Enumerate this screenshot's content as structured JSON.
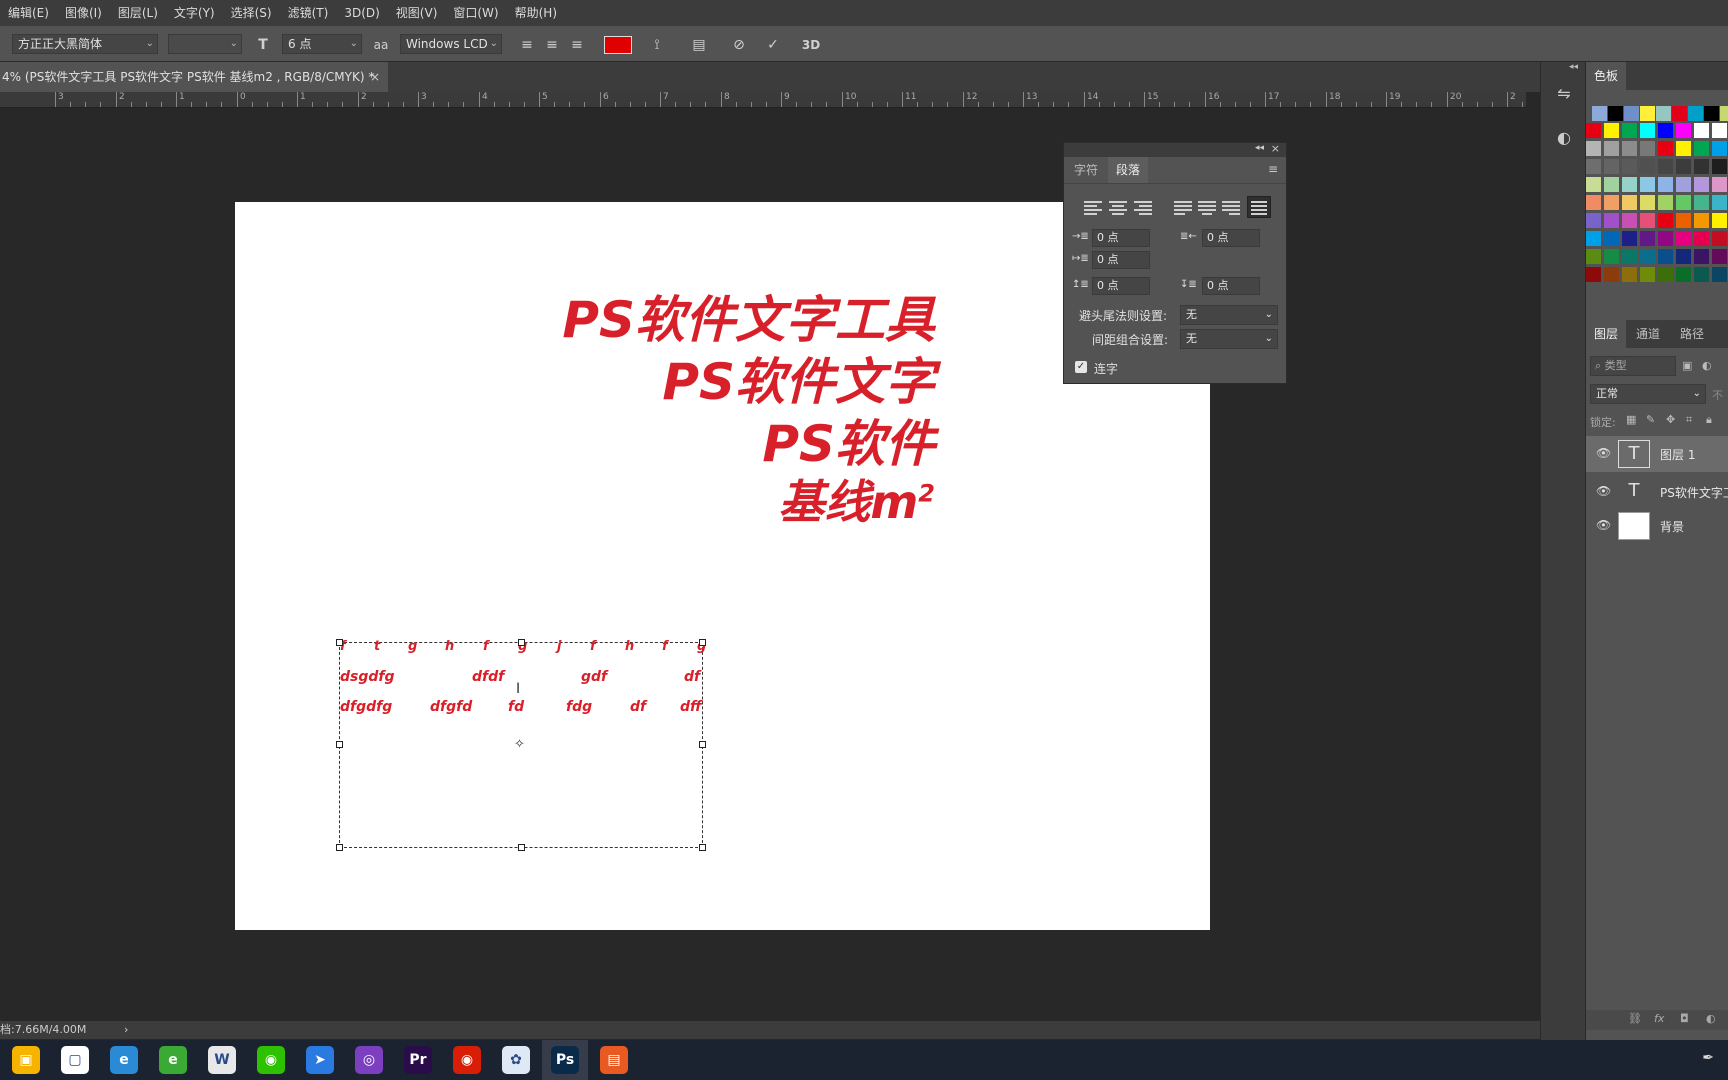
{
  "menu": [
    "编辑(E)",
    "图像(I)",
    "图层(L)",
    "文字(Y)",
    "选择(S)",
    "滤镜(T)",
    "3D(D)",
    "视图(V)",
    "窗口(W)",
    "帮助(H)"
  ],
  "options": {
    "font_family": "方正正大黑简体",
    "font_size": "6 点",
    "antialias_prefix": "aa",
    "antialias": "Windows LCD",
    "text_color": "#e00000",
    "threed_label": "3D"
  },
  "document_tab": {
    "title": "4% (PS软件文字工具 PS软件文字 PS软件 基线m2 , RGB/8/CMYK) *",
    "close": "×"
  },
  "ruler_labels": [
    "3",
    "2",
    "1",
    "0",
    "1",
    "2",
    "3",
    "4",
    "5",
    "6",
    "7",
    "8",
    "9",
    "10",
    "11",
    "12",
    "13",
    "14",
    "15",
    "16",
    "17",
    "18",
    "19",
    "20",
    "2"
  ],
  "canvas_text": {
    "line1": "PS软件文字工具",
    "line2": "PS软件文字",
    "line3": "PS软件",
    "line4": "基线m",
    "line4_sup": "2",
    "box_row1": [
      "f",
      "t",
      "g",
      "h",
      "f",
      "g",
      "j",
      "f",
      "h",
      "f",
      "g"
    ],
    "box_row2": [
      "dsgdfg",
      "dfdf",
      "gdf",
      "df"
    ],
    "box_row3": [
      "dfgdfg",
      "dfgfd",
      "fd",
      "fdg",
      "df",
      "dff"
    ],
    "cursor": "I",
    "center_marker": "✧"
  },
  "paragraph_panel": {
    "tabs": [
      "字符",
      "段落"
    ],
    "active_tab": "段落",
    "fields": {
      "indent_left": "0 点",
      "indent_right": "0 点",
      "indent_first": "0 点",
      "space_before": "0 点",
      "space_after": "0 点"
    },
    "kinsoku_label": "避头尾法则设置:",
    "kinsoku_value": "无",
    "mojikumi_label": "间距组合设置:",
    "mojikumi_value": "无",
    "hyphenate_label": "连字",
    "hyphenate_checked": true
  },
  "swatches_panel": {
    "tab": "色板",
    "colors": [
      [
        "#8ea8d8",
        "#000000",
        "#6f8fc9",
        "#ffef3b",
        "#96c6c0",
        "#e0001a",
        "#00a0c8",
        "#000000",
        "#c8d86e"
      ],
      [
        "#e60012",
        "#fff100",
        "#00a650",
        "#00ffff",
        "#0000ff",
        "#ff00ff",
        "#ffffff",
        "#ffffff",
        "#ffffff"
      ],
      [
        "#b4b4b4",
        "#a0a0a0",
        "#8c8c8c",
        "#787878",
        "#e60012",
        "#fff100",
        "#00a650",
        "#00a0e9",
        "#1d2088"
      ],
      [
        "#6e6e6e",
        "#646464",
        "#5a5a5a",
        "#505050",
        "#464646",
        "#3c3c3c",
        "#323232",
        "#1e1e1e",
        "#000000"
      ],
      [
        "#c8dc96",
        "#a0d2a0",
        "#96d2c8",
        "#8cc8e6",
        "#8cb4e6",
        "#a0a0dc",
        "#b496dc",
        "#dc96c8",
        "#e696a0"
      ],
      [
        "#f08c64",
        "#f0a064",
        "#f0c864",
        "#dcdc64",
        "#a0d264",
        "#64c864",
        "#46b48c",
        "#3cb4c8",
        "#5096dc"
      ],
      [
        "#7864c8",
        "#a050c8",
        "#c850b4",
        "#e65078",
        "#e60012",
        "#eb6100",
        "#f39800",
        "#fff100",
        "#8fc31f"
      ],
      [
        "#00a0e9",
        "#0068b7",
        "#1d2088",
        "#601986",
        "#920783",
        "#e4007f",
        "#e5004f",
        "#c30d23",
        "#a40000"
      ],
      [
        "#5a8c14",
        "#148c46",
        "#0a7864",
        "#0a6e8c",
        "#0a4e8c",
        "#14287a",
        "#3c1464",
        "#640a5a",
        "#8c0a3c"
      ],
      [
        "#8c0a0a",
        "#8c3c0a",
        "#8c6e0a",
        "#6e8c0a",
        "#3c6e0a",
        "#0a6e28",
        "#0a5a50",
        "#0a4664",
        "#0a2864"
      ]
    ]
  },
  "layers_panel": {
    "tabs": [
      "图层",
      "通道",
      "路径"
    ],
    "search_placeholder": "类型",
    "blend_mode": "正常",
    "opacity_label": "不",
    "lock_label": "锁定:",
    "layers": [
      {
        "name": "图层 1",
        "type": "text"
      },
      {
        "name": "PS软件文字工",
        "type": "text"
      },
      {
        "name": "背景",
        "type": "background"
      }
    ]
  },
  "status": {
    "doc_info": "档:7.66M/4.00M",
    "arrow": "›"
  },
  "taskbar": {
    "apps": [
      {
        "name": "store",
        "glyph": "▣",
        "color": "#f6b400"
      },
      {
        "name": "file",
        "glyph": "▢",
        "color": "#ffffff"
      },
      {
        "name": "ie",
        "glyph": "e",
        "color": "#2a8ad6"
      },
      {
        "name": "browser360",
        "glyph": "e",
        "color": "#3aaa35"
      },
      {
        "name": "writer",
        "glyph": "W",
        "color": "#e8e8e8"
      },
      {
        "name": "wechat",
        "glyph": "◉",
        "color": "#2dc100"
      },
      {
        "name": "feishu",
        "glyph": "➤",
        "color": "#2a7ae2"
      },
      {
        "name": "bbb",
        "glyph": "◎",
        "color": "#7b3fbf"
      },
      {
        "name": "premiere",
        "glyph": "Pr",
        "color": "#2a0c4a"
      },
      {
        "name": "netease-music",
        "glyph": "◉",
        "color": "#d81e06"
      },
      {
        "name": "baidu-netdisk",
        "glyph": "✿",
        "color": "#dfe8f5"
      },
      {
        "name": "photoshop",
        "glyph": "Ps",
        "color": "#0a2a4a"
      },
      {
        "name": "office",
        "glyph": "▤",
        "color": "#e85a21"
      }
    ]
  }
}
